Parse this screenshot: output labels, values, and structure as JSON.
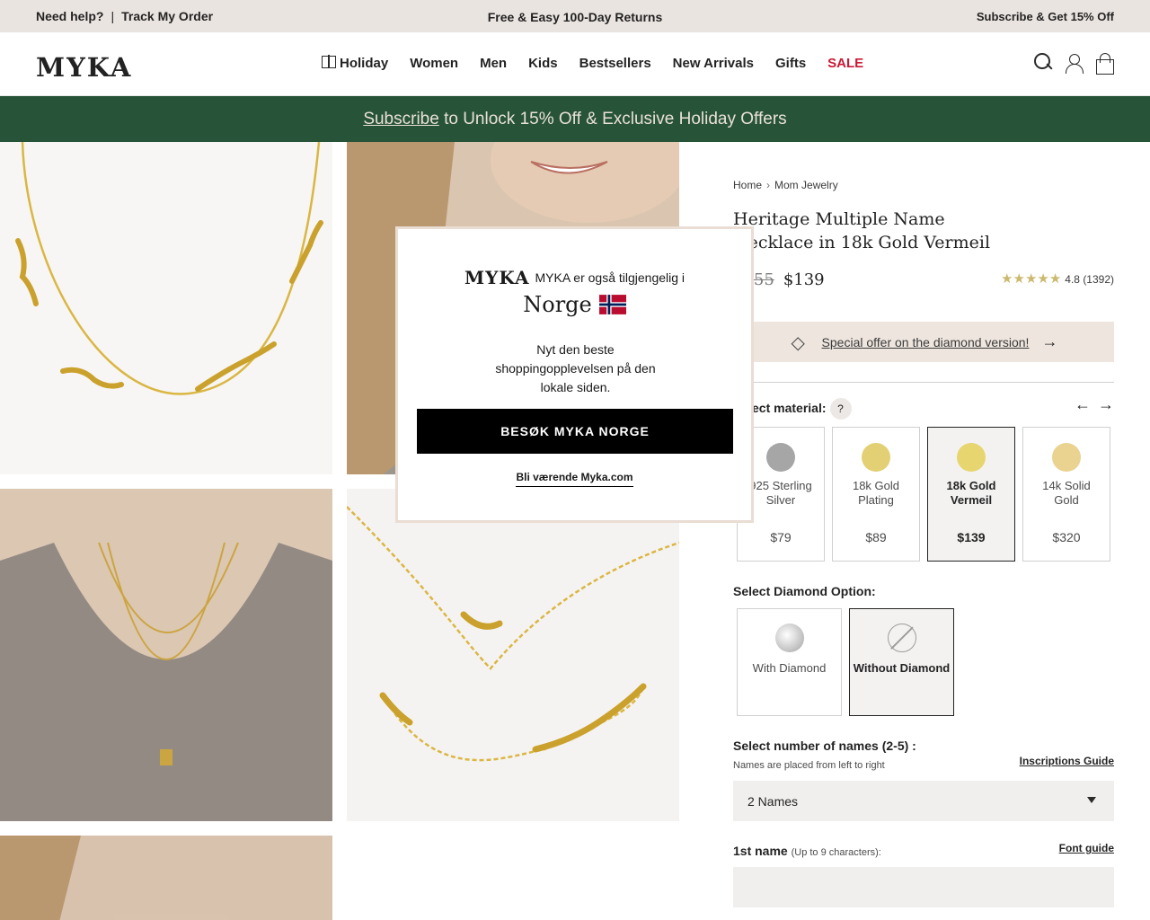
{
  "topbar": {
    "help": "Need help?",
    "separator": "|",
    "track": "Track My Order",
    "returns": "Free & Easy 100-Day Returns",
    "subscribe": "Subscribe & Get 15% Off"
  },
  "nav": {
    "logo": "MYKA",
    "items": [
      "Holiday",
      "Women",
      "Men",
      "Kids",
      "Bestsellers",
      "New Arrivals",
      "Gifts",
      "SALE"
    ],
    "icons": [
      "search-icon",
      "user-icon",
      "bag-icon",
      "gift-icon"
    ]
  },
  "promo": {
    "link": "Subscribe",
    "text": " to Unlock 15% Off & Exclusive Holiday Offers"
  },
  "product": {
    "breadcrumb": [
      "Home",
      "Mom Jewelry"
    ],
    "breadcrumb_sep": "›",
    "title": "Heritage Multiple Name Necklace in 18k Gold Vermeil",
    "old_price": "$155",
    "price": "$139",
    "stars": "★★★★★",
    "rating": "4.8 (1392)",
    "special_offer": "Special offer on the diamond version!",
    "material_label": "Select material:",
    "help_badge": "?",
    "arrow_left": "←",
    "arrow_right": "→",
    "materials": [
      {
        "name": "925 Sterling Silver",
        "price": "$79",
        "color": "#a3a3a3"
      },
      {
        "name": "18k Gold Plating",
        "price": "$89",
        "color": "#e2cf70"
      },
      {
        "name": "18k Gold Vermeil",
        "price": "$139",
        "color": "#e7d46a",
        "selected": true
      },
      {
        "name": "14k Solid Gold",
        "price": "$320",
        "color": "#ead18c"
      }
    ],
    "diamond_label": "Select Diamond Option:",
    "diamonds": [
      {
        "name": "With Diamond"
      },
      {
        "name": "Without Diamond",
        "selected": true
      }
    ],
    "names_label": "Select number of names (2-5) :",
    "names_note": "Names are placed from left to right",
    "inscriptions_guide": "Inscriptions Guide",
    "names_value": "2 Names",
    "first_name_label": "1st name",
    "first_name_hint": "(Up to 9 characters):",
    "font_guide": "Font guide",
    "first_name_value": ""
  },
  "modal": {
    "logo": "MYKA",
    "available": "MYKA er også tilgjengelig i",
    "country": "Norge",
    "body": "Nyt den beste shoppingopplevelsen på den lokale siden.",
    "button": "BESØK MYKA NORGE",
    "stay": "Bli værende Myka.com"
  },
  "colors": {
    "promo_bg": "#1f4c30",
    "topbar_bg": "#eae3df",
    "sale": "#c8102e",
    "star": "#c9b76a"
  }
}
